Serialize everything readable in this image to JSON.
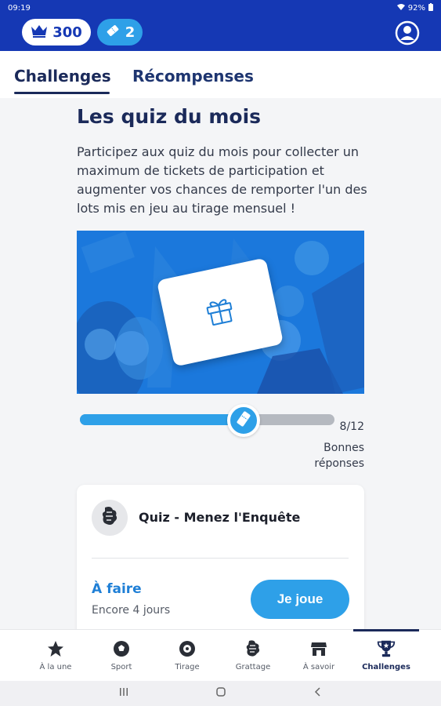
{
  "status_bar": {
    "time": "09:19",
    "battery": "92%"
  },
  "header": {
    "crown_count": "300",
    "ticket_count": "2"
  },
  "tabs": [
    {
      "label": "Challenges",
      "active": true
    },
    {
      "label": "Récompenses",
      "active": false
    }
  ],
  "content": {
    "title": "Les quiz du mois",
    "description": "Participez aux quiz du mois pour collecter un maximum de tickets de participation et augmenter vos chances de remporter l'un des lots mis en jeu au tirage mensuel !"
  },
  "progress": {
    "count": "8/12",
    "label": "Bonnes réponses",
    "fraction": 0.667
  },
  "quiz": {
    "name": "Quiz - Menez l'Enquête",
    "status": "À faire",
    "remaining": "Encore 4 jours",
    "button": "Je joue"
  },
  "bottom_nav": [
    {
      "label": "À la une",
      "icon": "star-icon"
    },
    {
      "label": "Sport",
      "icon": "soccer-ball-icon"
    },
    {
      "label": "Tirage",
      "icon": "lottery-ball-icon"
    },
    {
      "label": "Grattage",
      "icon": "scratch-coin-icon"
    },
    {
      "label": "À savoir",
      "icon": "store-icon"
    },
    {
      "label": "Challenges",
      "icon": "trophy-icon",
      "active": true
    }
  ],
  "colors": {
    "primary": "#1538b4",
    "accent": "#2ea0e8",
    "navy": "#1b2a5a"
  }
}
